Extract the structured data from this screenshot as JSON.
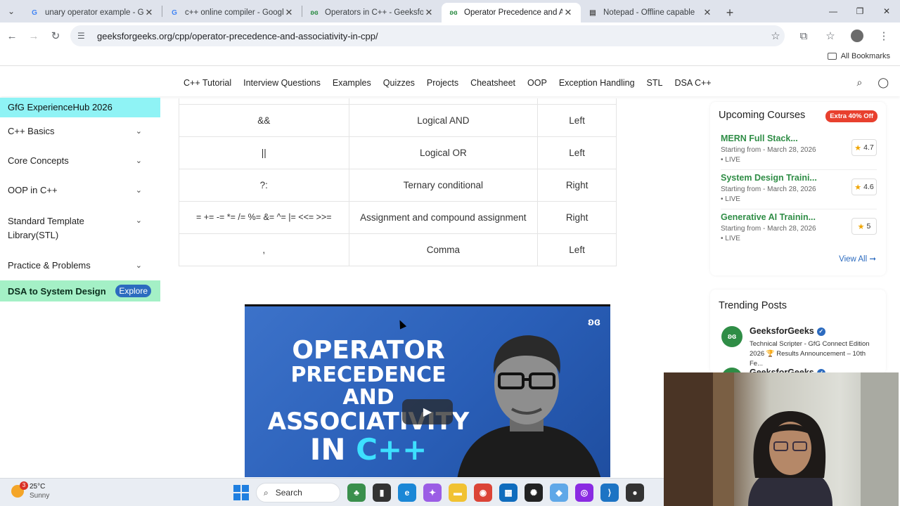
{
  "browser": {
    "tabs": [
      {
        "title": "unary operator example - Goog",
        "favicon": "google-icon",
        "active": false
      },
      {
        "title": "c++ online compiler - Google S",
        "favicon": "google-icon",
        "active": false
      },
      {
        "title": "Operators in C++ - GeeksforGe",
        "favicon": "gfg-icon",
        "active": false
      },
      {
        "title": "Operator Precedence and Asso",
        "favicon": "gfg-icon",
        "active": true
      },
      {
        "title": "Notepad - Offline capable",
        "favicon": "notepad-icon",
        "active": false
      }
    ],
    "url": "geeksforgeeks.org/cpp/operator-precedence-and-associativity-in-cpp/",
    "all_bookmarks_label": "All Bookmarks"
  },
  "site_nav": {
    "links": [
      "C++ Tutorial",
      "Interview Questions",
      "Examples",
      "Quizzes",
      "Projects",
      "Cheatsheet",
      "OOP",
      "Exception Handling",
      "STL",
      "DSA C++"
    ]
  },
  "sidebar": {
    "top_label": "GfG ExperienceHub 2026",
    "items": [
      "C++ Basics",
      "Core Concepts",
      "OOP in C++",
      "Standard Template Library(STL)",
      "Practice & Problems"
    ],
    "dsa_label": "DSA to System Design",
    "explore_label": "Explore"
  },
  "operator_table": {
    "rows": [
      {
        "operator": "&&",
        "description": "Logical AND",
        "associativity": "Left"
      },
      {
        "operator": "||",
        "description": "Logical OR",
        "associativity": "Left"
      },
      {
        "operator": "?:",
        "description": "Ternary conditional",
        "associativity": "Right"
      },
      {
        "operator": "= += -= *= /= %= &= ^= |= <<= >>=",
        "description": "Assignment and compound assignment",
        "associativity": "Right"
      },
      {
        "operator": ",",
        "description": "Comma",
        "associativity": "Left"
      }
    ]
  },
  "video": {
    "title_lines": [
      "OPERATOR",
      "PRECEDENCE AND",
      "ASSOCIATIVITY",
      "IN"
    ],
    "title_cpp": "C++"
  },
  "upcoming_courses": {
    "heading": "Upcoming Courses",
    "badge": "Extra 40% Off",
    "courses": [
      {
        "name": "MERN Full Stack...",
        "date": "Starting from - March 28, 2026",
        "status": "• LIVE",
        "rating": "4.7"
      },
      {
        "name": "System Design Traini...",
        "date": "Starting from - March 28, 2026",
        "status": "• LIVE",
        "rating": "4.6"
      },
      {
        "name": "Generative AI Trainin...",
        "date": "Starting from - March 28, 2026",
        "status": "• LIVE",
        "rating": "5"
      }
    ],
    "view_all": "View All ➞"
  },
  "trending_posts": {
    "heading": "Trending Posts",
    "posts": [
      {
        "author": "GeeksforGeeks",
        "text": "Technical Scripter - GfG Connect Edition 2026 🏆 Results Announcement – 10th Fe..."
      },
      {
        "author": "GeeksforGeeks",
        "text": ""
      }
    ]
  },
  "taskbar": {
    "weather_temp": "25°C",
    "weather_desc": "Sunny",
    "weather_badge": "3",
    "search_label": "Search"
  },
  "colors": {
    "gfg_green": "#2f8d46",
    "sidebar_top": "#8ff3f5",
    "sidebar_dsa": "#a4f0c6",
    "link_blue": "#2c6bbf"
  }
}
